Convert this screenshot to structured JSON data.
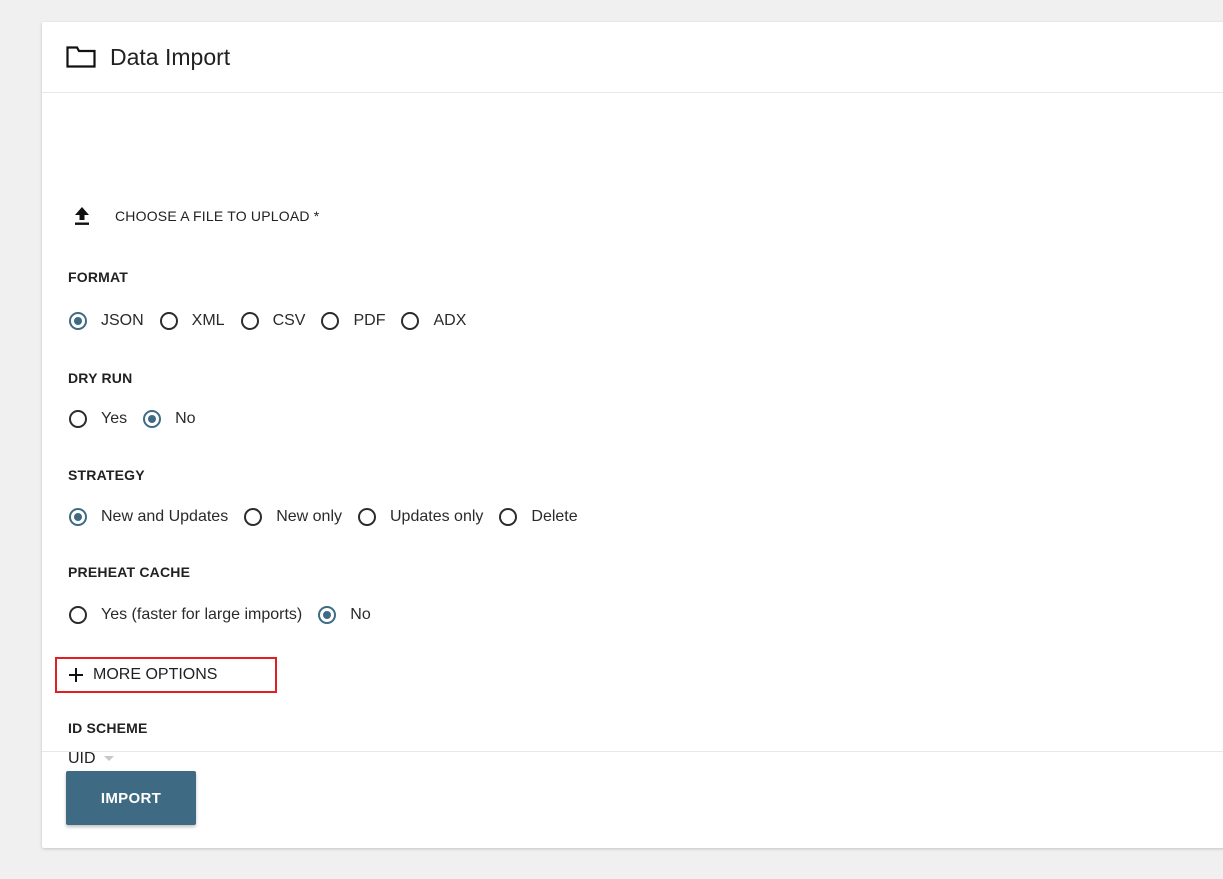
{
  "header": {
    "title": "Data Import",
    "icon": "folder-icon"
  },
  "upload": {
    "label": "CHOOSE A FILE TO UPLOAD *",
    "icon": "upload-icon"
  },
  "format": {
    "label": "FORMAT",
    "options": [
      {
        "label": "JSON",
        "selected": true
      },
      {
        "label": "XML",
        "selected": false
      },
      {
        "label": "CSV",
        "selected": false
      },
      {
        "label": "PDF",
        "selected": false
      },
      {
        "label": "ADX",
        "selected": false
      }
    ]
  },
  "dry_run": {
    "label": "DRY RUN",
    "options": [
      {
        "label": "Yes",
        "selected": false
      },
      {
        "label": "No",
        "selected": true
      }
    ]
  },
  "strategy": {
    "label": "STRATEGY",
    "options": [
      {
        "label": "New and Updates",
        "selected": true
      },
      {
        "label": "New only",
        "selected": false
      },
      {
        "label": "Updates only",
        "selected": false
      },
      {
        "label": "Delete",
        "selected": false
      }
    ]
  },
  "preheat_cache": {
    "label": "PREHEAT CACHE",
    "options": [
      {
        "label": "Yes (faster for large imports)",
        "selected": false
      },
      {
        "label": "No",
        "selected": true
      }
    ]
  },
  "more_options": {
    "label": "MORE OPTIONS",
    "icon": "plus-icon"
  },
  "id_scheme": {
    "label": "ID SCHEME",
    "value": "UID",
    "icon": "caret-down-icon"
  },
  "actions": {
    "import_label": "IMPORT"
  },
  "colors": {
    "accent": "#3f6a84",
    "highlight_border": "#e02020",
    "background": "#f0f0f0"
  }
}
